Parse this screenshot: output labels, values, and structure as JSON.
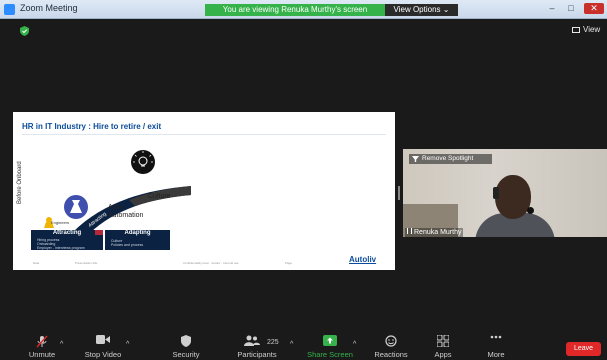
{
  "window": {
    "title": "Zoom Meeting",
    "controls": {
      "minimize": "–",
      "maximize": "□",
      "close": "✕"
    }
  },
  "banner": {
    "text": "You are viewing Renuka Murthy's screen",
    "view_options": "View Options ⌄"
  },
  "top_bar": {
    "view_label": "View"
  },
  "slide": {
    "title": "HR in IT Industry : Hire to retire / exit",
    "vertical_label": "Before Onboard",
    "arc_adapting": "Adapting",
    "arc_attracting": "Attracting",
    "culture": "Culture",
    "agile_line1": "Agile",
    "agile_line2": "Automation",
    "engineers": "Engineers",
    "box_attracting": {
      "title": "Attracting",
      "items": [
        "Hiring process",
        "Onboarding",
        "Employer - Interviews program"
      ]
    },
    "box_adapting": {
      "title": "Adapting",
      "items": [
        "Culture",
        "Policies and process"
      ]
    },
    "footer_left": "Date",
    "footer_mid1": "Presentation title",
    "footer_mid2": "Confidentiality level · Autoliv · Internal use",
    "footer_right": "Page",
    "logo": "Autoliv"
  },
  "spotlight": {
    "remove_label": "Remove Spotlight",
    "participant_name": "Renuka Murthy"
  },
  "toolbar": {
    "mute": "Unmute",
    "stop_video": "Stop Video",
    "security": "Security",
    "participants": "Participants",
    "participants_count": "225",
    "share_screen": "Share Screen",
    "reactions": "Reactions",
    "apps": "Apps",
    "more": "More",
    "leave": "Leave"
  },
  "colors": {
    "share_green": "#35b24a",
    "leave_red": "#e02828",
    "slide_navy": "#0b2242",
    "slide_blue": "#0a4c9b"
  }
}
